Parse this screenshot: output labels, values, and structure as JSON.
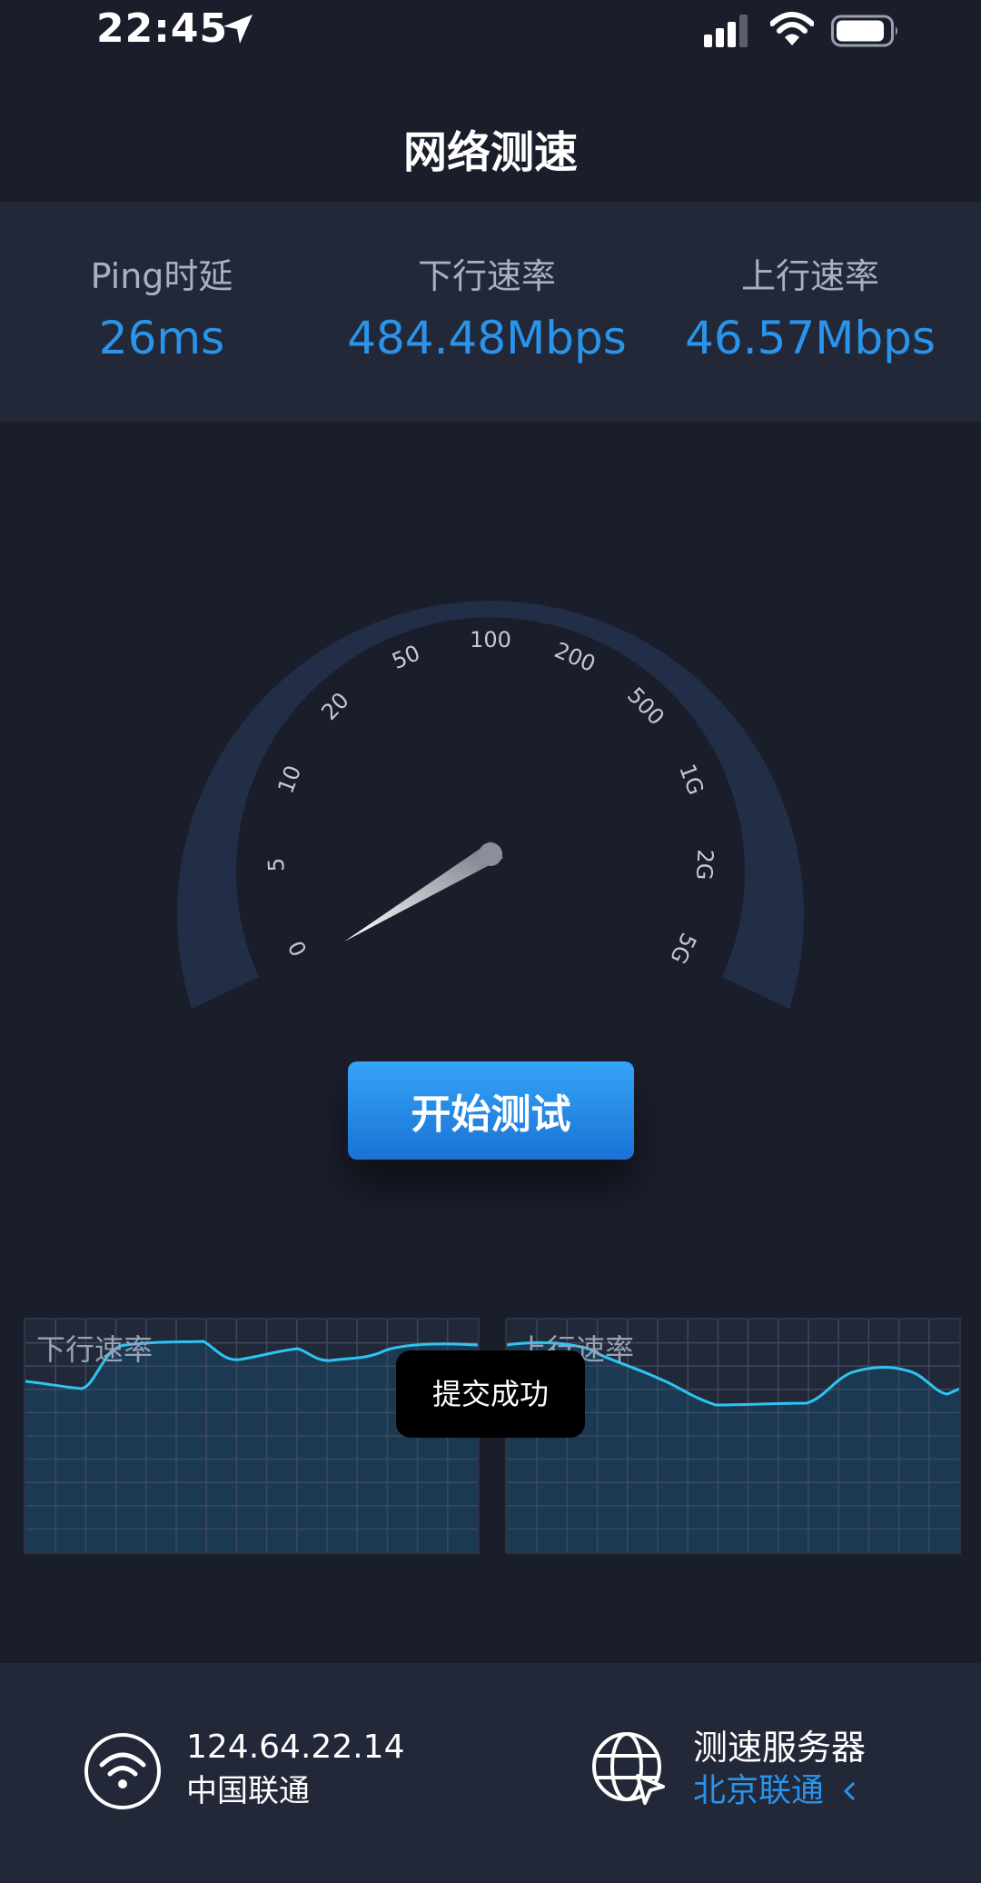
{
  "status_bar": {
    "time": "22:45"
  },
  "nav": {
    "title": "网络测速"
  },
  "stats": {
    "ping_label": "Ping时延",
    "ping_value": "26ms",
    "download_label": "下行速率",
    "download_value": "484.48Mbps",
    "upload_label": "上行速率",
    "upload_value": "46.57Mbps"
  },
  "gauge": {
    "ticks": [
      "0",
      "5",
      "10",
      "20",
      "50",
      "100",
      "200",
      "500",
      "1G",
      "2G",
      "5G"
    ]
  },
  "start_button": {
    "label": "开始测试"
  },
  "download_chart": {
    "label": "下行速率"
  },
  "upload_chart": {
    "label": "上行速率"
  },
  "toast": {
    "text": "提交成功"
  },
  "footer": {
    "ip": "124.64.22.14",
    "isp": "中国联通",
    "server_title": "测速服务器",
    "server_name": "北京联通"
  },
  "colors": {
    "background": "#1a1e2b",
    "panel": "#232839",
    "accent": "#2a94ea",
    "chart_line": "#2ec4f2"
  },
  "icons": [
    "location-arrow-icon",
    "cellular-signal-icon",
    "wifi-icon",
    "battery-icon",
    "globe-cursor-icon",
    "caret-left-icon"
  ]
}
